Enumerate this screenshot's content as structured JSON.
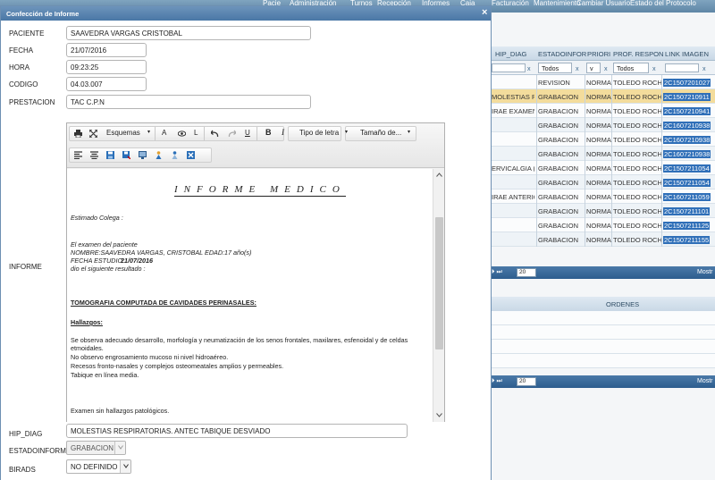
{
  "topnav": {
    "items": [
      "Pacie",
      "Administración",
      "Turnos",
      "Recepción",
      "Informes",
      "Caja",
      "Facturación",
      "Mantenimiento",
      "Cambiar Usuario",
      "Estado del Protocolo"
    ]
  },
  "bg_grid": {
    "columns": [
      "HIP_DIAG",
      "ESTADOINFOR",
      "PRIORI",
      "PROF. RESPON",
      "LINK IMAGEN"
    ],
    "filters": {
      "estado": "Todos",
      "prof": "Todos"
    },
    "rows": [
      {
        "hip": "",
        "estado": "REVISION",
        "priori": "NORMAL",
        "prof": "TOLEDO ROCH",
        "link": "2C1507201027",
        "selected": false
      },
      {
        "hip": "MOLESTIAS RE",
        "estado": "GRABACION",
        "priori": "NORMAL",
        "prof": "TOLEDO ROCH",
        "link": "2C1507210911",
        "selected": true
      },
      {
        "hip": "IRAE EXAMENE",
        "estado": "GRABACION",
        "priori": "NORMAL",
        "prof": "TOLEDO ROCH",
        "link": "2C1507210941",
        "selected": false
      },
      {
        "hip": "",
        "estado": "GRABACION",
        "priori": "NORMAL",
        "prof": "TOLEDO ROCH",
        "link": "2C1607210938",
        "selected": false
      },
      {
        "hip": "",
        "estado": "GRABACION",
        "priori": "NORMAL",
        "prof": "TOLEDO ROCH",
        "link": "2C1607210938",
        "selected": false
      },
      {
        "hip": "",
        "estado": "GRABACION",
        "priori": "NORMAL",
        "prof": "TOLEDO ROCH",
        "link": "2C1607210938",
        "selected": false
      },
      {
        "hip": "ERVICALGIA (",
        "estado": "GRABACION",
        "priori": "NORMAL",
        "prof": "TOLEDO ROCH",
        "link": "2C1507211054",
        "selected": false
      },
      {
        "hip": "",
        "estado": "GRABACION",
        "priori": "NORMAL",
        "prof": "TOLEDO ROCH",
        "link": "2C1507211054",
        "selected": false
      },
      {
        "hip": "IRAE ANTERIO",
        "estado": "GRABACION",
        "priori": "NORMAL",
        "prof": "TOLEDO ROCH",
        "link": "2C1607211059",
        "selected": false
      },
      {
        "hip": "",
        "estado": "GRABACION",
        "priori": "NORMAL",
        "prof": "TOLEDO ROCH",
        "link": "2C1507211101",
        "selected": false
      },
      {
        "hip": "",
        "estado": "GRABACION",
        "priori": "NORMAL",
        "prof": "TOLEDO ROCH",
        "link": "2C1507211125",
        "selected": false
      },
      {
        "hip": "",
        "estado": "GRABACION",
        "priori": "NORMAL",
        "prof": "TOLEDO ROCH",
        "link": "2C1507211155",
        "selected": false
      }
    ],
    "pager1": {
      "size": "20",
      "mostrar": "Mostr"
    },
    "ordenes_label": "ORDENES",
    "pager2": {
      "size": "20",
      "mostrar": "Mostr"
    }
  },
  "modal": {
    "title": "Confección de Informe",
    "close": "×",
    "labels": {
      "paciente": "PACIENTE",
      "fecha": "FECHA",
      "hora": "HORA",
      "codigo": "CODIGO",
      "prestacion": "PRESTACION",
      "informe": "INFORME",
      "hip_diag": "HIP_DIAG",
      "estado": "ESTADOINFORME",
      "birads": "BIRADS"
    },
    "values": {
      "paciente": "SAAVEDRA VARGAS CRISTOBAL",
      "fecha": "21/07/2016",
      "hora": "09:23:25",
      "codigo": "04.03.007",
      "prestacion": "TAC C.P.N",
      "hip_diag": "MOLESTIAS RESPIRATORIAS. ANTEC TABIQUE DESVIADO",
      "estado": "GRABACION",
      "birads": "NO DEFINIDO"
    },
    "toolbar": {
      "esquemas": "Esquemas",
      "font_a": "A",
      "font_l": "L",
      "underline": "U",
      "bold": "B",
      "italic": "I",
      "tipo_letra": "Tipo de letra",
      "tamano": "Tamaño de..."
    },
    "document": {
      "title": "INFORME MEDICO",
      "greeting": "Estimado Colega :",
      "line1": "El examen del paciente",
      "line2": "NOMBRE:SAAVEDRA VARGAS, CRISTOBAL    EDAD:17 año(s)",
      "line3a": "FECHA ESTUDIO:",
      "line3b": "21/07/2016",
      "line4": "dio el siguiente resultado :",
      "heading": "TOMOGRAFIA COMPUTADA DE CAVIDADES PERINASALES:",
      "hallazgos": "Hallazgos:",
      "p1a": "Se observa adecuado desarrollo, morfología y neumatización de los senos frontales, maxilares, esfenoidal y de celdas",
      "p1b": "etmoidales.",
      "p2": "No observo engrosamiento mucoso ni nivel hidroaéreo.",
      "p3": "Recesos fronto-nasales y complejos osteomeatales amplios y permeables.",
      "p4": "Tabique en línea media.",
      "p5": "Examen sin hallazgos patológicos."
    }
  },
  "colors": {
    "title_bar": "#4a77a6",
    "selected_row": "#f3dc9c",
    "link_bg": "#2f6fb8"
  }
}
